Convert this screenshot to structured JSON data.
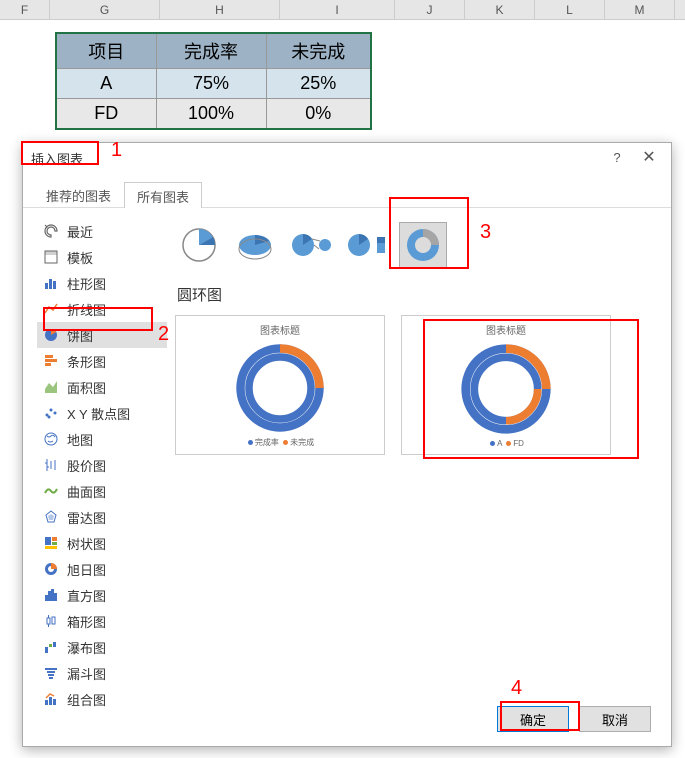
{
  "sheet": {
    "columns": [
      "F",
      "G",
      "H",
      "I",
      "J",
      "K",
      "L",
      "M"
    ],
    "table": {
      "headers": [
        "项目",
        "完成率",
        "未完成"
      ],
      "rows": [
        [
          "A",
          "75%",
          "25%"
        ],
        [
          "FD",
          "100%",
          "0%"
        ]
      ]
    }
  },
  "dialog": {
    "title": "插入图表",
    "help": "?",
    "close": "✕",
    "tabs": {
      "recommended": "推荐的图表",
      "all": "所有图表"
    },
    "sidebar": [
      "最近",
      "模板",
      "柱形图",
      "折线图",
      "饼图",
      "条形图",
      "面积图",
      "X Y 散点图",
      "地图",
      "股价图",
      "曲面图",
      "雷达图",
      "树状图",
      "旭日图",
      "直方图",
      "箱形图",
      "瀑布图",
      "漏斗图",
      "组合图"
    ],
    "subtype_title": "圆环图",
    "preview1": {
      "title": "图表标题",
      "legend1": "完成率",
      "legend2": "未完成"
    },
    "preview2": {
      "title": "图表标题",
      "legend1": "A",
      "legend2": "FD"
    },
    "buttons": {
      "ok": "确定",
      "cancel": "取消"
    }
  },
  "annotations": {
    "n1": "1",
    "n2": "2",
    "n3": "3",
    "n4": "4"
  },
  "chart_data": {
    "type": "pie",
    "variant": "doughnut",
    "previews": [
      {
        "title": "图表标题",
        "series": [
          {
            "name": "完成率",
            "values": [
              75,
              100
            ]
          },
          {
            "name": "未完成",
            "values": [
              25,
              0
            ]
          }
        ],
        "categories": [
          "A",
          "FD"
        ]
      },
      {
        "title": "图表标题",
        "series": [
          {
            "name": "A",
            "values": [
              75,
              25
            ]
          },
          {
            "name": "FD",
            "values": [
              100,
              0
            ]
          }
        ],
        "categories": [
          "完成率",
          "未完成"
        ]
      }
    ]
  }
}
